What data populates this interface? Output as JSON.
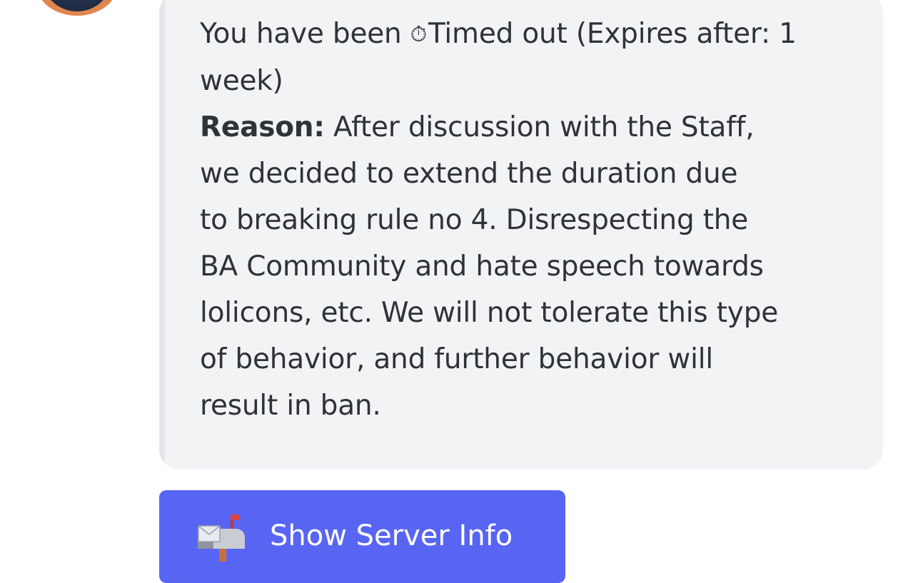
{
  "embed": {
    "line1_prefix": "You have been ",
    "timer_glyph": "⏱",
    "line1_suffix": "Timed out (Expires after: 1",
    "line2": "week)",
    "reason_label": "Reason:",
    "reason_first": " After discussion with the Staff,",
    "reason_lines": [
      "we decided to extend the duration due",
      "to breaking rule no 4. Disrespecting the",
      "BA Community and hate speech towards",
      "lolicons, etc. We will not tolerate this type",
      "of behavior, and further behavior will",
      "result in ban."
    ]
  },
  "button": {
    "icon": "mailbox-icon",
    "label": "Show Server Info",
    "color": "#5865f2"
  },
  "colors": {
    "embed_background": "#f2f3f5",
    "text": "#2e3338",
    "avatar_ring": "#e0874e"
  }
}
